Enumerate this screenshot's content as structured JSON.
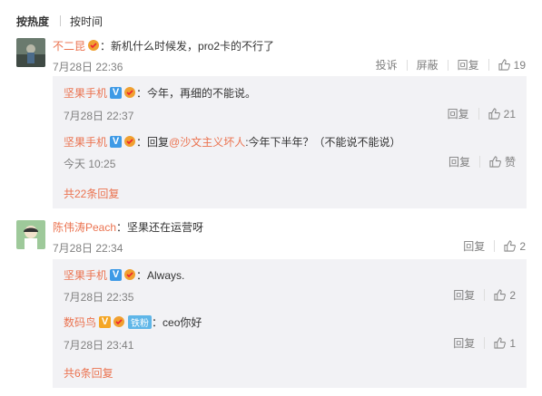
{
  "sort": {
    "hot": "按热度",
    "time": "按时间"
  },
  "comments": [
    {
      "user": "不二昆",
      "text": "：新机什么时候发，pro2卡的不行了",
      "date": "7月28日 22:36",
      "actions": [
        "投诉",
        "屏蔽",
        "回复"
      ],
      "likes": "19",
      "replies": [
        {
          "user": "坚果手机",
          "text": "：今年，再细的不能说。",
          "date": "7月28日 22:37",
          "reply": "回复",
          "likes": "21"
        },
        {
          "user": "坚果手机",
          "prefix": "：回复",
          "mention": "@沙文主义坏人",
          "text": ":今年下半年？（不能说不能说）",
          "date": "今天 10:25",
          "reply": "回复",
          "likes": "赞"
        }
      ],
      "more": "共22条回复"
    },
    {
      "user": "陈伟涛Peach",
      "text": "：坚果还在运营呀",
      "date": "7月28日 22:34",
      "actions": [
        "回复"
      ],
      "likes": "2",
      "replies": [
        {
          "user": "坚果手机",
          "text": "：Always.",
          "date": "7月28日 22:35",
          "reply": "回复",
          "likes": "2"
        },
        {
          "user": "数码鸟",
          "badge": "铁粉",
          "text": "：ceo你好",
          "date": "7月28日 23:41",
          "reply": "回复",
          "likes": "1"
        }
      ],
      "more": "共6条回复"
    }
  ],
  "colors": {
    "accent": "#eb7350",
    "vblue": "#3e9ae6",
    "vgold": "#f5a623",
    "replybg": "#f2f2f5"
  }
}
